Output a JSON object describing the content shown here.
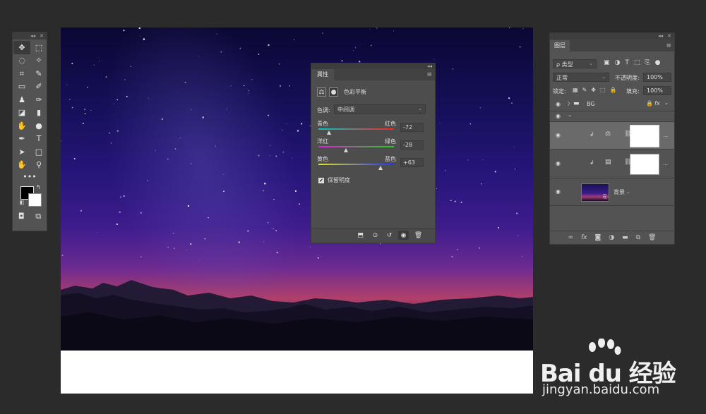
{
  "tools": {
    "items": [
      {
        "name": "move-tool",
        "glyph": "✥"
      },
      {
        "name": "marquee-tool",
        "glyph": "⬚"
      },
      {
        "name": "lasso-tool",
        "glyph": "◌"
      },
      {
        "name": "magic-wand-tool",
        "glyph": "✧"
      },
      {
        "name": "crop-tool",
        "glyph": "⌗"
      },
      {
        "name": "eyedropper-tool",
        "glyph": "✎"
      },
      {
        "name": "frame-tool",
        "glyph": "▭"
      },
      {
        "name": "brush-tool",
        "glyph": "✐"
      },
      {
        "name": "stamp-tool",
        "glyph": "♟"
      },
      {
        "name": "history-brush-tool",
        "glyph": "✑"
      },
      {
        "name": "eraser-tool",
        "glyph": "◪"
      },
      {
        "name": "gradient-tool",
        "glyph": "▮"
      },
      {
        "name": "blur-tool",
        "glyph": "✋"
      },
      {
        "name": "dodge-tool",
        "glyph": "●"
      },
      {
        "name": "pen-tool",
        "glyph": "✒"
      },
      {
        "name": "type-tool",
        "glyph": "T"
      },
      {
        "name": "path-select-tool",
        "glyph": "➤"
      },
      {
        "name": "shape-tool",
        "glyph": "□"
      },
      {
        "name": "hand-tool",
        "glyph": "✋"
      },
      {
        "name": "zoom-tool",
        "glyph": "⚲"
      }
    ],
    "more": "•••",
    "bottom": [
      "◘",
      "⧉"
    ]
  },
  "properties": {
    "tab": "属性",
    "adjustment_name": "色彩平衡",
    "tone_label": "色调:",
    "tone_value": "中间调",
    "sliders": [
      {
        "left": "青色",
        "right": "红色",
        "value": "-72",
        "pos": 0.14,
        "colors": [
          "#00c8c8",
          "#ff2020"
        ]
      },
      {
        "left": "洋红",
        "right": "绿色",
        "value": "-28",
        "pos": 0.36,
        "colors": [
          "#e020e0",
          "#20d020"
        ]
      },
      {
        "left": "黄色",
        "right": "蓝色",
        "value": "+63",
        "pos": 0.82,
        "colors": [
          "#e8e020",
          "#2030ff"
        ]
      }
    ],
    "preserve_luminosity": "保留明度",
    "preserve_checked": "✔"
  },
  "layers": {
    "tab": "图层",
    "filter_label": "ρ 类型",
    "blend_mode": "正常",
    "opacity_label": "不透明度:",
    "opacity_value": "100%",
    "lock_label": "锁定:",
    "fill_label": "填充:",
    "fill_value": "100%",
    "group_name": "BG",
    "fx_label": "fx",
    "background_layer": "背景"
  },
  "watermark": {
    "main": "Bai du 经验",
    "sub": "jingyan.baidu.com"
  },
  "colors": {
    "panel": "#535353",
    "background": "#2b2b2b",
    "accent_selected": "#6a6a6a"
  }
}
